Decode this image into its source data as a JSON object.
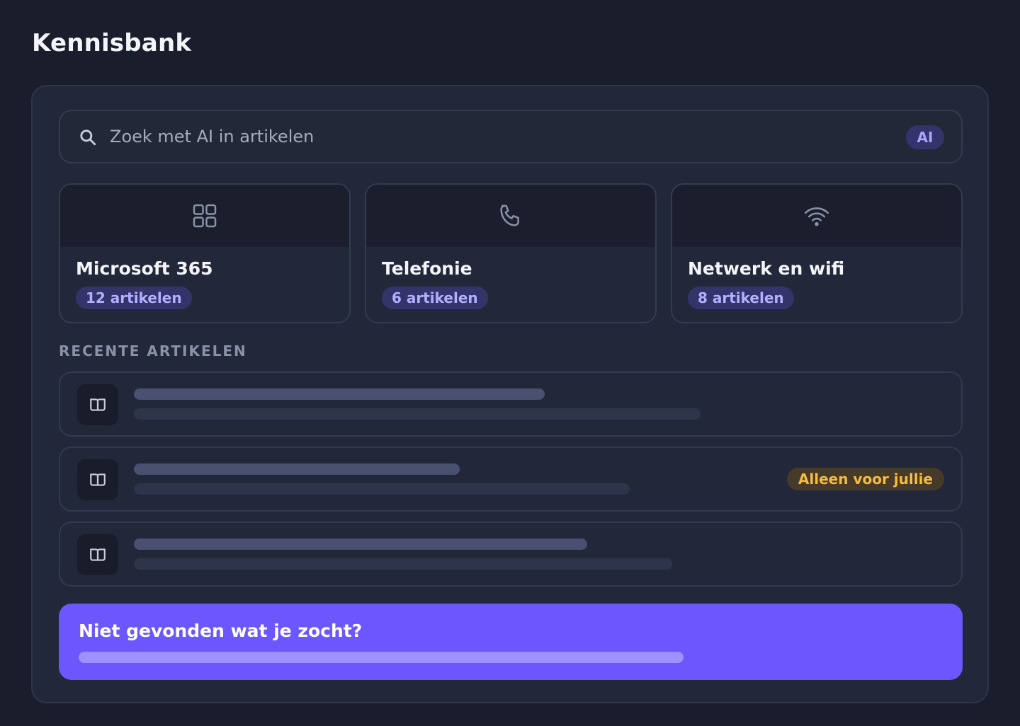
{
  "page": {
    "title": "Kennisbank"
  },
  "search": {
    "placeholder": "Zoek met AI in artikelen",
    "ai_badge": "AI"
  },
  "categories": [
    {
      "name": "Microsoft 365",
      "count": "12 artikelen",
      "icon": "grid-icon"
    },
    {
      "name": "Telefonie",
      "count": "6 artikelen",
      "icon": "phone-icon"
    },
    {
      "name": "Netwerk en wifi",
      "count": "8 artikelen",
      "icon": "wifi-icon"
    }
  ],
  "recent": {
    "label": "RECENTE ARTIKELEN",
    "items": [
      {
        "icon": "book-icon"
      },
      {
        "icon": "book-icon",
        "badge": "Alleen voor jullie"
      },
      {
        "icon": "book-icon"
      }
    ]
  },
  "cta": {
    "title": "Niet gevonden wat je zocht?"
  },
  "colors": {
    "background": "#1a1e2c",
    "panel": "#22273a",
    "accent": "#6b57fd",
    "badge_text": "#b2b0ff",
    "private_badge": "#f7bc3e"
  }
}
